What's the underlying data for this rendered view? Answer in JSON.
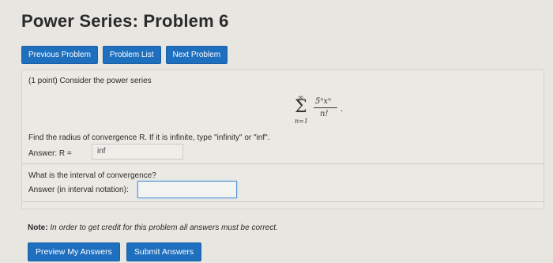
{
  "page": {
    "title": "Power Series: Problem 6"
  },
  "nav": {
    "previous": "Previous Problem",
    "list": "Problem List",
    "next": "Next Problem"
  },
  "problem": {
    "points": "(1 point) Consider the power series",
    "formula": {
      "upper": "∞",
      "sigma": "Σ",
      "lower": "n=1",
      "numerator": "5ⁿxⁿ",
      "denominator": "n!",
      "trail": "."
    },
    "question1": "Find the radius of convergence R. If it is infinite, type \"infinity\" or \"inf\".",
    "answer1_label": "Answer: R =",
    "answer1_value": "inf",
    "question2": "What is the interval of convergence?",
    "answer2_label": "Answer (in interval notation):",
    "answer2_value": ""
  },
  "note": {
    "label": "Note:",
    "text": "In order to get credit for this problem all answers must be correct."
  },
  "actions": {
    "preview": "Preview My Answers",
    "submit": "Submit Answers"
  },
  "colors": {
    "button": "#1f6fbf",
    "background": "#e8e6e1"
  }
}
